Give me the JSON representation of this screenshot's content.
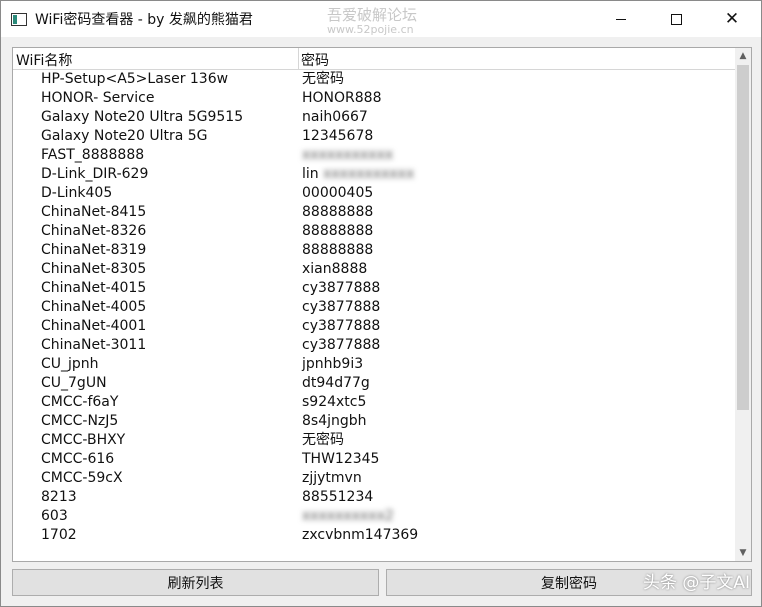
{
  "window": {
    "title": "WiFi密码查看器 - by 发飙的熊猫君",
    "watermark_line1": "吾爱破解论坛",
    "watermark_line2": "www.52pojie.cn"
  },
  "list": {
    "columns": {
      "name": "WiFi名称",
      "password": "密码"
    },
    "rows": [
      {
        "name": "HP-Setup<A5>Laser 136w",
        "password": "无密码"
      },
      {
        "name": "HONOR- Service",
        "password": "HONOR888"
      },
      {
        "name": "Galaxy Note20 Ultra 5G9515",
        "password": "naih0667"
      },
      {
        "name": "Galaxy Note20 Ultra 5G",
        "password": "12345678"
      },
      {
        "name": "FAST_8888888",
        "password": "xxxxxxxxxxx"
      },
      {
        "name": "D-Link_DIR-629",
        "password": "lin xxxxxxxxxxx"
      },
      {
        "name": "D-Link405",
        "password": "00000405"
      },
      {
        "name": "ChinaNet-8415",
        "password": "88888888"
      },
      {
        "name": "ChinaNet-8326",
        "password": "88888888"
      },
      {
        "name": "ChinaNet-8319",
        "password": "88888888"
      },
      {
        "name": "ChinaNet-8305",
        "password": "xian8888"
      },
      {
        "name": "ChinaNet-4015",
        "password": "cy3877888"
      },
      {
        "name": "ChinaNet-4005",
        "password": "cy3877888"
      },
      {
        "name": "ChinaNet-4001",
        "password": "cy3877888"
      },
      {
        "name": "ChinaNet-3011",
        "password": "cy3877888"
      },
      {
        "name": "CU_jpnh",
        "password": "jpnhb9i3"
      },
      {
        "name": "CU_7gUN",
        "password": "dt94d77g"
      },
      {
        "name": "CMCC-f6aY",
        "password": "s924xtc5"
      },
      {
        "name": "CMCC-NzJ5",
        "password": "8s4jngbh"
      },
      {
        "name": "CMCC-BHXY",
        "password": "无密码"
      },
      {
        "name": "CMCC-616",
        "password": "THW12345"
      },
      {
        "name": "CMCC-59cX",
        "password": "zjjytmvn"
      },
      {
        "name": "8213",
        "password": "88551234"
      },
      {
        "name": "603",
        "password": "xxxxxxxxxx2"
      },
      {
        "name": "1702",
        "password": "zxcvbnm147369"
      }
    ]
  },
  "buttons": {
    "refresh": "刷新列表",
    "copy": "复制密码"
  },
  "corner_watermark": "头条 @子文AI"
}
